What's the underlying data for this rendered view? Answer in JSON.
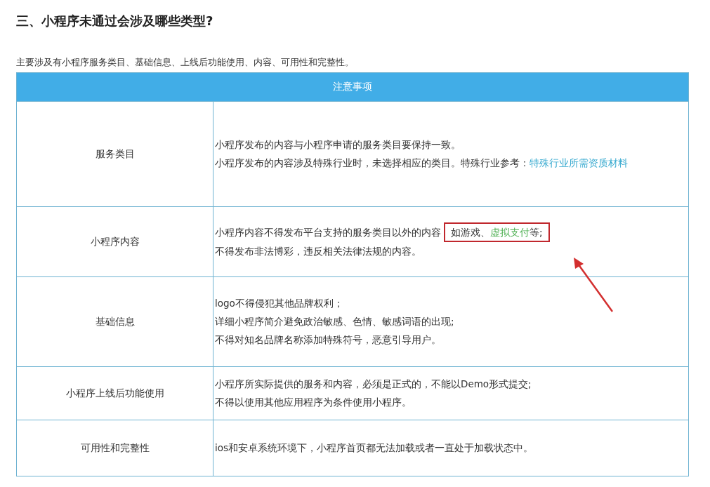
{
  "heading": "三、小程序未通过会涉及哪些类型?",
  "intro": "主要涉及有小程序服务类目、基础信息、上线后功能使用、内容、可用性和完整性。",
  "table": {
    "header": "注意事项",
    "rows": [
      {
        "category": "服务类目",
        "lines": [
          [
            {
              "kind": "text",
              "text": "小程序发布的内容与小程序申请的服务类目要保持一致。"
            }
          ],
          [
            {
              "kind": "text",
              "text": "小程序发布的内容涉及特殊行业时，未选择相应的类目。特殊行业参考："
            },
            {
              "kind": "link",
              "text": "特殊行业所需资质材料"
            }
          ]
        ]
      },
      {
        "category": "小程序内容",
        "lines": [
          [
            {
              "kind": "text",
              "text": "小程序内容不得发布平台支持的服务类目以外的内容"
            },
            {
              "kind": "boxed",
              "parts": [
                {
                  "text": "如游戏、",
                  "accent": false
                },
                {
                  "text": "虚拟支付",
                  "accent": true
                },
                {
                  "text": "等;",
                  "accent": false
                }
              ]
            }
          ],
          [
            {
              "kind": "text",
              "text": "不得发布非法博彩，违反相关法律法规的内容。"
            }
          ]
        ]
      },
      {
        "category": "基础信息",
        "lines": [
          [
            {
              "kind": "text",
              "text": "logo不得侵犯其他品牌权利；"
            }
          ],
          [
            {
              "kind": "text",
              "text": "详细小程序简介避免政治敏感、色情、敏感词语的出现;"
            }
          ],
          [
            {
              "kind": "text",
              "text": "不得对知名品牌名称添加特殊符号，恶意引导用户。"
            }
          ]
        ]
      },
      {
        "category": "小程序上线后功能使用",
        "lines": [
          [
            {
              "kind": "text",
              "text": "小程序所实际提供的服务和内容，必须是正式的，不能以Demo形式提交;"
            }
          ],
          [
            {
              "kind": "text",
              "text": "不得以使用其他应用程序为条件使用小程序。"
            }
          ]
        ]
      },
      {
        "category": "可用性和完整性",
        "lines": [
          [
            {
              "kind": "text",
              "text": "ios和安卓系统环境下，小程序首页都无法加载或者一直处于加载状态中。"
            }
          ]
        ]
      }
    ]
  }
}
